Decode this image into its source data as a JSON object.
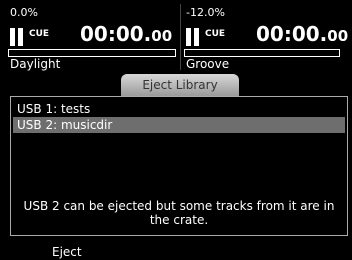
{
  "deck_left": {
    "pitch": "0.0%",
    "cue_label": "CUE",
    "time_main": "00:00.",
    "time_ms": "00",
    "track_name": "Daylight"
  },
  "deck_right": {
    "pitch": "-12.0%",
    "cue_label": "CUE",
    "time_main": "00:00.",
    "time_ms": "00",
    "track_name": "Groove"
  },
  "dialog": {
    "tab_title": "Eject Library",
    "items": [
      {
        "label": "USB 1: tests",
        "selected": false
      },
      {
        "label": "USB 2: musicdir",
        "selected": true
      }
    ],
    "message": "USB 2 can be ejected but some tracks from it are in the crate."
  },
  "footer": {
    "eject_label": "Eject"
  },
  "colors": {
    "background": "#000000",
    "text": "#ffffff",
    "selection": "#6e6e6e",
    "tab": "#c0c0c0"
  }
}
